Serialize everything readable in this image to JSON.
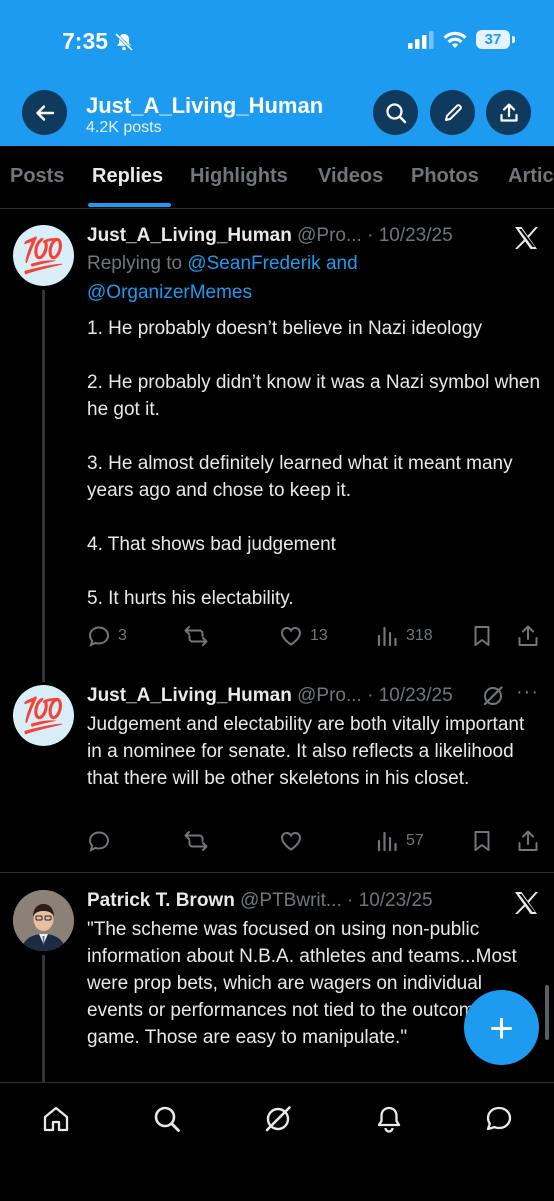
{
  "status_bar": {
    "time": "7:35",
    "battery": "37"
  },
  "header": {
    "name": "Just_A_Living_Human",
    "post_count": "4.2K posts",
    "icons": [
      "back-arrow-icon",
      "search-icon",
      "pencil-icon",
      "share-icon"
    ]
  },
  "tabs": [
    "Posts",
    "Replies",
    "Highlights",
    "Videos",
    "Photos",
    "Artic"
  ],
  "active_tab": "Replies",
  "tweets": [
    {
      "name": "Just_A_Living_Human",
      "handle": "@Pro...",
      "date": "· 10/23/25",
      "avatar_emoji": "💯",
      "corner_icon": "x-logo-icon",
      "replying_prefix": "Replying to ",
      "replying_user1": "@SeanFrederik",
      "replying_and": " and",
      "replying_user2": "@OrganizerMemes",
      "paragraphs": [
        "1. He probably doesn’t believe in Nazi ideology",
        "2. He probably didn’t know it was a Nazi symbol when he got it.",
        "3. He almost definitely learned what it meant many years ago and chose to keep it.",
        "4. That shows bad judgement",
        "5. It hurts his electability."
      ],
      "replies": "3",
      "reposts": "",
      "likes": "13",
      "views": "318"
    },
    {
      "name": "Just_A_Living_Human",
      "handle": "@Pro...",
      "date": "· 10/23/25",
      "avatar_emoji": "💯",
      "corner_icon": "grok-icon",
      "more": "···",
      "paragraphs": [
        "Judgement and electability are both vitally important in a nominee for senate. It also reflects a likelihood that there will be other skeletons in his closet."
      ],
      "replies": "",
      "reposts": "",
      "likes": "",
      "views": "57"
    },
    {
      "name": "Patrick T. Brown",
      "handle": "@PTBwrit...",
      "date": "· 10/23/25",
      "corner_icon": "x-logo-icon",
      "paragraphs": [
        "\"The scheme was focused on using non-public information about N.B.A. athletes and teams...Most were prop bets, which are wagers on individual events or performances not tied to the outcome of a game. Those are easy to manipulate.\""
      ]
    }
  ],
  "compose_button": "+",
  "bottom_nav": [
    "home-icon",
    "search-icon",
    "grok-icon",
    "bell-icon",
    "messages-icon"
  ],
  "colors": {
    "accent": "#1d9bf0",
    "background": "#000000",
    "text": "#e7e9ea",
    "muted": "#71767b"
  }
}
